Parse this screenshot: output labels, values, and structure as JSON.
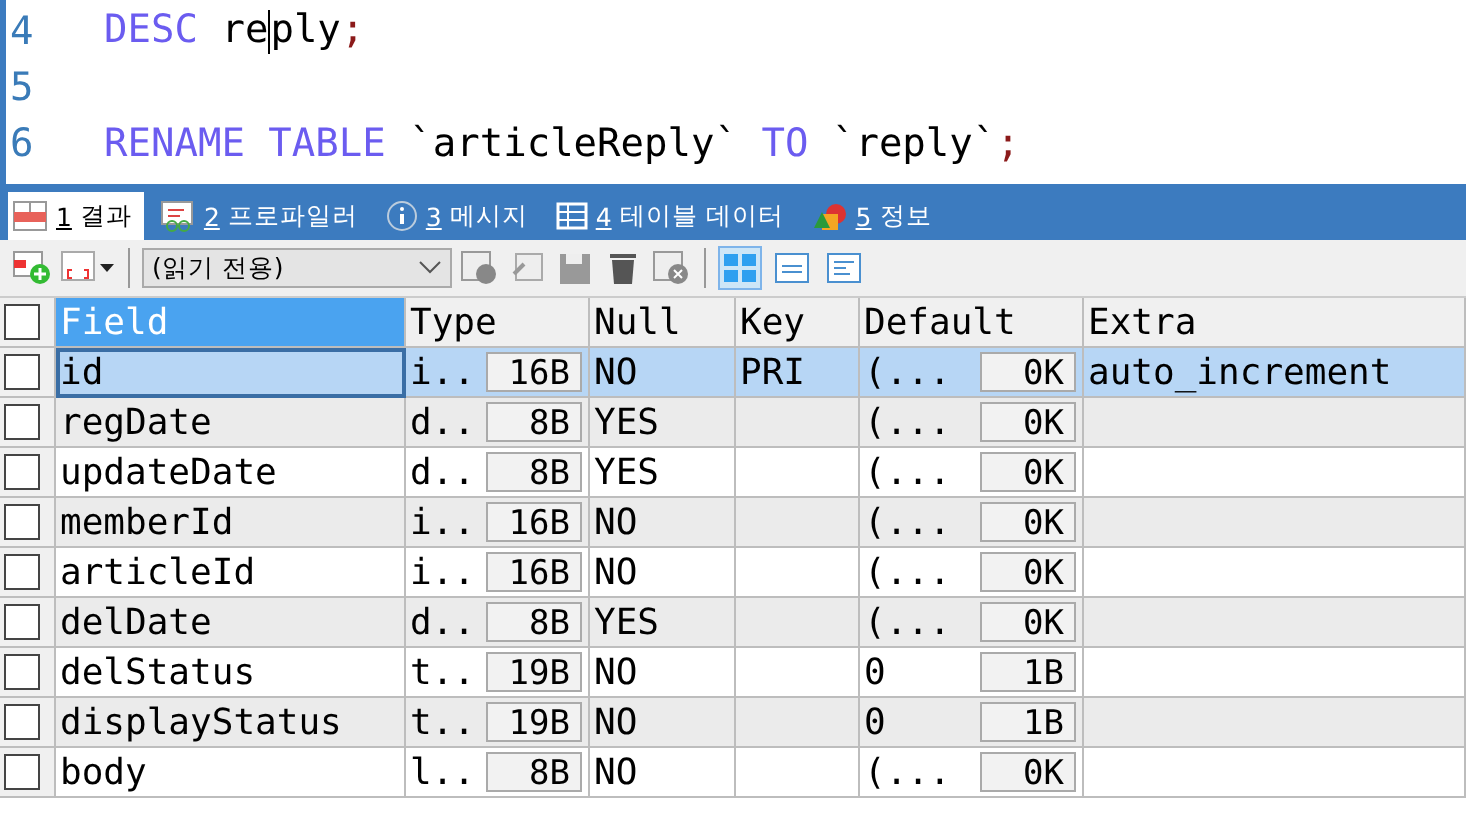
{
  "editor": {
    "lines": [
      {
        "number": "4",
        "tokens": [
          {
            "kind": "keyword",
            "text": "DESC"
          },
          {
            "kind": "plain",
            "text": " re"
          },
          {
            "kind": "cursor"
          },
          {
            "kind": "plain",
            "text": "ply"
          },
          {
            "kind": "punct",
            "text": ";"
          }
        ]
      },
      {
        "number": "5"
      },
      {
        "number": "6",
        "tokens": [
          {
            "kind": "keyword",
            "text": "RENAME TABLE"
          },
          {
            "kind": "plain",
            "text": " `articleReply` "
          },
          {
            "kind": "keyword",
            "text": "TO"
          },
          {
            "kind": "plain",
            "text": " `reply`"
          },
          {
            "kind": "punct",
            "text": ";"
          }
        ]
      }
    ]
  },
  "tabs": [
    {
      "number": "1",
      "label": "결과",
      "kind": "grid",
      "selected": true
    },
    {
      "number": "2",
      "label": "프로파일러",
      "kind": "profiler",
      "selected": false
    },
    {
      "number": "3",
      "label": "메시지",
      "kind": "info",
      "selected": false
    },
    {
      "number": "4",
      "label": "테이블 데이터",
      "kind": "table",
      "selected": false
    },
    {
      "number": "5",
      "label": "정보",
      "kind": "shapes",
      "selected": false
    }
  ],
  "toolbar": {
    "mode": "(읽기 전용)",
    "view": [
      {
        "selected": true
      },
      {
        "selected": false
      },
      {
        "selected": false
      }
    ]
  },
  "grid": {
    "columns": [
      {
        "label": "Field",
        "selected": true
      },
      {
        "label": "Type",
        "selected": false
      },
      {
        "label": "Null",
        "selected": false
      },
      {
        "label": "Key",
        "selected": false
      },
      {
        "label": "Default",
        "selected": false
      },
      {
        "label": "Extra",
        "selected": false
      }
    ],
    "rows": [
      {
        "checked": false,
        "selected": true,
        "field": "id",
        "type": "i..",
        "type_size": "16B",
        "null": "NO",
        "key": "PRI",
        "default": "(...",
        "default_size": "0K",
        "extra": "auto_increment"
      },
      {
        "checked": false,
        "selected": false,
        "field": "regDate",
        "type": "d..",
        "type_size": "8B",
        "null": "YES",
        "default": "(...",
        "default_size": "0K"
      },
      {
        "checked": false,
        "selected": false,
        "field": "updateDate",
        "type": "d..",
        "type_size": "8B",
        "null": "YES",
        "default": "(...",
        "default_size": "0K"
      },
      {
        "checked": false,
        "selected": false,
        "field": "memberId",
        "type": "i..",
        "type_size": "16B",
        "null": "NO",
        "default": "(...",
        "default_size": "0K"
      },
      {
        "checked": false,
        "selected": false,
        "field": "articleId",
        "type": "i..",
        "type_size": "16B",
        "null": "NO",
        "default": "(...",
        "default_size": "0K"
      },
      {
        "checked": false,
        "selected": false,
        "field": "delDate",
        "type": "d..",
        "type_size": "8B",
        "null": "YES",
        "default": "(...",
        "default_size": "0K"
      },
      {
        "checked": false,
        "selected": false,
        "field": "delStatus",
        "type": "t..",
        "type_size": "19B",
        "null": "NO",
        "default": "0",
        "default_size": "1B"
      },
      {
        "checked": false,
        "selected": false,
        "field": "displayStatus",
        "type": "t..",
        "type_size": "19B",
        "null": "NO",
        "default": "0",
        "default_size": "1B"
      },
      {
        "checked": false,
        "selected": false,
        "field": "body",
        "type": "l..",
        "type_size": "8B",
        "null": "NO",
        "default": "(...",
        "default_size": "0K"
      }
    ]
  }
}
